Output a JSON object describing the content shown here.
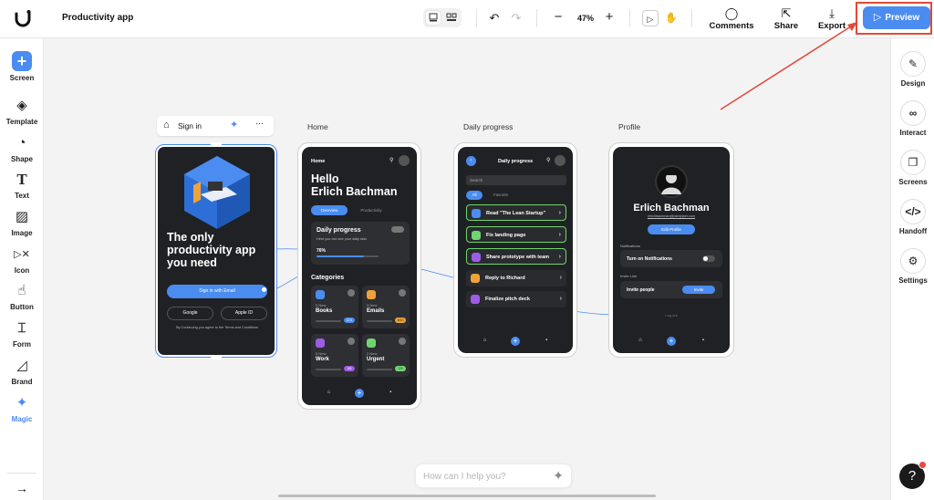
{
  "app": {
    "title": "Productivity app"
  },
  "toolbar": {
    "zoom": "47%",
    "comments_label": "Comments",
    "share_label": "Share",
    "export_label": "Export",
    "preview_label": "Preview",
    "accent": "#4a8cf0",
    "highlight": "#e24a38"
  },
  "left_sidebar": {
    "items": [
      {
        "label": "Screen",
        "icon": "plus-icon"
      },
      {
        "label": "Template",
        "icon": "layers-icon"
      },
      {
        "label": "Shape",
        "icon": "shapes-icon"
      },
      {
        "label": "Text",
        "icon": "text-icon"
      },
      {
        "label": "Image",
        "icon": "image-icon"
      },
      {
        "label": "Icon",
        "icon": "icon-icon"
      },
      {
        "label": "Button",
        "icon": "button-icon"
      },
      {
        "label": "Form",
        "icon": "form-icon"
      },
      {
        "label": "Brand",
        "icon": "brand-icon"
      },
      {
        "label": "Magic",
        "icon": "sparkle-icon"
      }
    ]
  },
  "right_sidebar": {
    "items": [
      {
        "label": "Design",
        "icon": "pencil-icon"
      },
      {
        "label": "Interact",
        "icon": "interact-icon"
      },
      {
        "label": "Screens",
        "icon": "screens-icon"
      },
      {
        "label": "Handoff",
        "icon": "code-icon"
      },
      {
        "label": "Settings",
        "icon": "gear-icon"
      }
    ]
  },
  "frames": {
    "signin": {
      "label": "Sign in",
      "headline": "The only productivity app you need",
      "primary_button": "Sign in with Email",
      "google_button": "Google",
      "apple_button": "Apple ID",
      "terms": "By Continuing you agree to the Terms and Conditions"
    },
    "home": {
      "label": "Home",
      "header": "Home",
      "greeting": "Hello\nErlich Bachman",
      "tab_overview": "Overview",
      "tab_productivity": "Productivity",
      "progress_title": "Daily progress",
      "progress_sub": "Here you can see your daily task",
      "progress_value": "76%",
      "progress_fraction": 0.76,
      "categories_title": "Categories",
      "categories": [
        {
          "count": "5 New",
          "name": "Books",
          "badge": "4/24",
          "color": "#4a8cf0"
        },
        {
          "count": "3 New",
          "name": "Emails",
          "badge": "8/10",
          "color": "#f0a23a"
        },
        {
          "count": "5 New",
          "name": "Work",
          "badge": "3/5",
          "color": "#9b5de5"
        },
        {
          "count": "2 New",
          "name": "Urgent",
          "badge": "7/9",
          "color": "#6fd66f"
        }
      ]
    },
    "daily": {
      "label": "Daily progress",
      "header": "Daily progress",
      "search": "Search",
      "tab_all": "All",
      "tab_favorite": "Favorite",
      "tasks": [
        {
          "text": "Read \"The Lean Startup\"",
          "color": "#4a8cf0"
        },
        {
          "text": "Fix landing page",
          "color": "#6fd66f"
        },
        {
          "text": "Share prototype with team",
          "color": "#9b5de5"
        },
        {
          "text": "Reply to Richard",
          "color": "#f0a23a"
        },
        {
          "text": "Finalize pitch deck",
          "color": "#9b5de5"
        }
      ]
    },
    "profile": {
      "label": "Profile",
      "name": "Erlich Bachman",
      "email": "erlichbachman@piedpiper.com",
      "edit_button": "Edit Profile",
      "notifications_label": "Notifications",
      "notifications_row": "Turn on Notifications",
      "invite_label": "Invite Link",
      "invite_row": "Invite people",
      "invite_button": "Invite",
      "logout": "Log out"
    }
  },
  "assistant": {
    "placeholder": "How can I help you?"
  },
  "help": {
    "label": "?"
  }
}
